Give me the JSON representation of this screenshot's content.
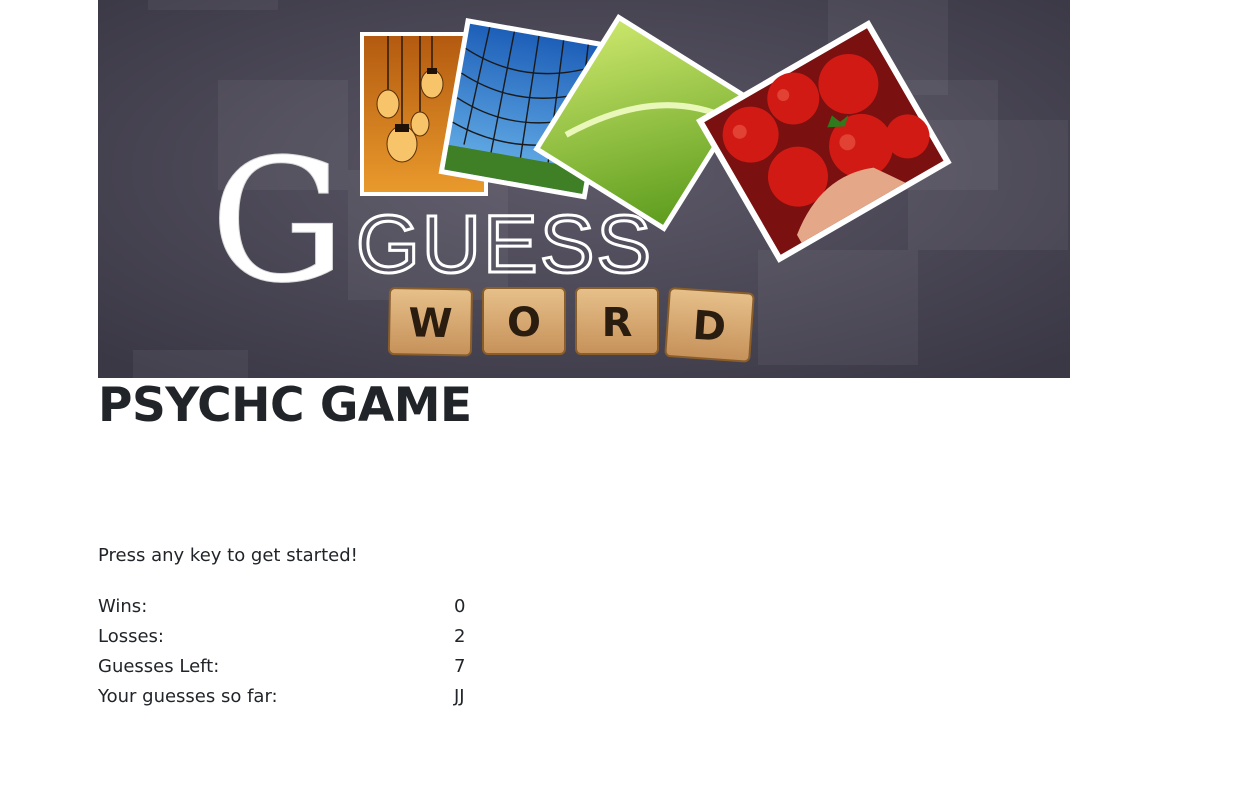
{
  "banner": {
    "logo_word_top": "GUESS",
    "tiles": [
      "W",
      "O",
      "R",
      "D"
    ]
  },
  "title": "PSYCHC GAME",
  "instructions": "Press any key to get started!",
  "stats": [
    {
      "label": "Wins:",
      "value": "0"
    },
    {
      "label": "Losses:",
      "value": "2"
    },
    {
      "label": "Guesses Left:",
      "value": "7"
    },
    {
      "label": "Your guesses so far:",
      "value": "JJ"
    }
  ],
  "colors": {
    "banner_bg": "#4a4656",
    "tile": "#d6a96b",
    "text": "#212529"
  }
}
